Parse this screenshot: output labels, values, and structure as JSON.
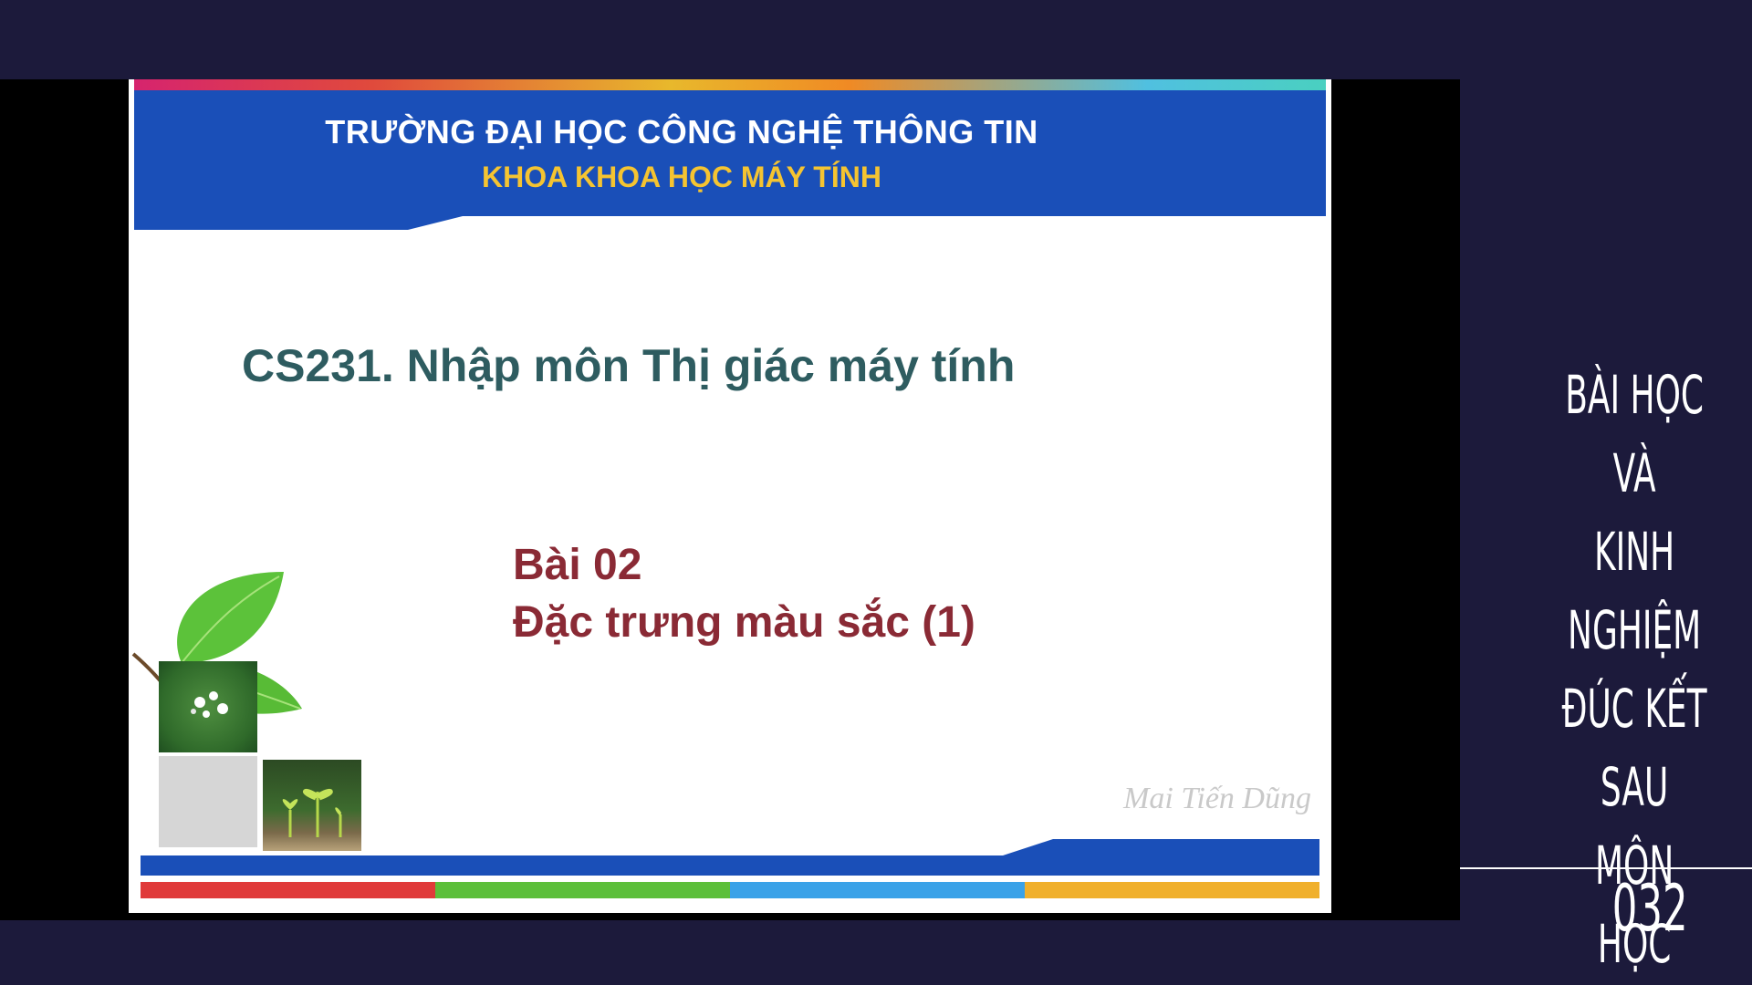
{
  "slide": {
    "header_title": "TRƯỜNG ĐẠI HỌC CÔNG NGHỆ THÔNG TIN",
    "header_subtitle": "KHOA KHOA HỌC MÁY TÍNH",
    "course_title": "CS231. Nhập môn Thị giác máy tính",
    "lesson_number": "Bài 02",
    "lesson_title": "Đặc trưng màu sắc (1)",
    "author": "Mai Tiến Dũng",
    "colors": {
      "header_blue": "#1a4fb8",
      "header_subtitle": "#f5c431",
      "course_title": "#2e5c60",
      "lesson_text": "#8a2a35",
      "footer_stripes": [
        "#e03a3a",
        "#5cbf3a",
        "#3aa2e8",
        "#f0b02c"
      ]
    }
  },
  "side_panel": {
    "title_lines": [
      "BÀI HỌC VÀ",
      "KINH NGHIỆM",
      "ĐÚC KẾT SAU",
      "MÔN HỌC"
    ],
    "page_number": "032",
    "background": "#1c1a3b"
  }
}
